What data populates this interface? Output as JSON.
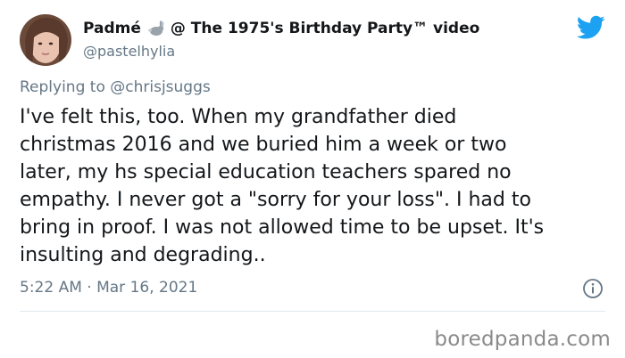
{
  "author": {
    "display_name": "Padmé",
    "emoji_icon": "rabbit-icon",
    "name_suffix": "@ The 1975's Birthday Party™ video",
    "handle": "@pastelhylia"
  },
  "reply": {
    "prefix": "Replying to",
    "mention": "@chrisjsuggs"
  },
  "tweet": {
    "lines": [
      "I've felt this, too. When my grandfather died",
      "christmas 2016 and we buried him a week or two",
      "later, my hs special education teachers spared no",
      "empathy. I never got a \"sorry for your loss\". I had to",
      "bring in proof. I was not allowed time to be upset. It's",
      "insulting and degrading.."
    ],
    "timestamp": "5:22 AM · Mar 16, 2021"
  },
  "icons": {
    "brand": "twitter-bird-icon",
    "info": "info-icon"
  },
  "watermark": "boredpanda.com",
  "colors": {
    "twitter_blue": "#1da1f2",
    "secondary_text": "#657786",
    "primary_text": "#14171a",
    "divider": "#e1e8ed"
  }
}
